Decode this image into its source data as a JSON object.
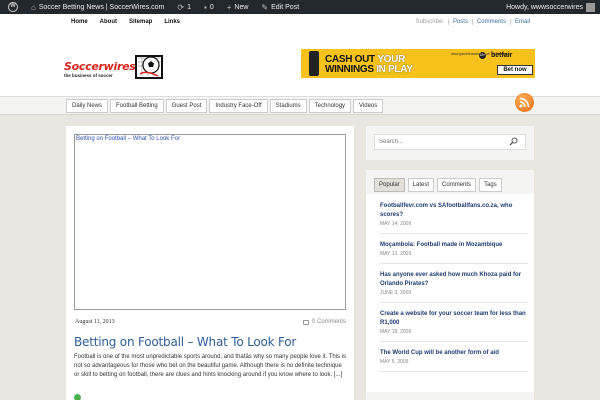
{
  "admin_bar": {
    "site_name": "Soccer Betting News | SoccerWires.com",
    "updates_count": "1",
    "comments_count": "0",
    "new_label": "New",
    "edit_label": "Edit Post",
    "howdy": "Howdy, wwwsoccerwires"
  },
  "top_nav": [
    "Home",
    "About",
    "Sitemap",
    "Links"
  ],
  "subscribe": {
    "label": "Subscribe:",
    "links": [
      "Posts",
      "Comments",
      "Email"
    ]
  },
  "logo": {
    "name": "Soccerwires",
    "tagline": "the business of soccer"
  },
  "banner": {
    "line1_a": "CASH OUT ",
    "line1_b": "YOUR",
    "line2_a": "WINNINGS ",
    "line2_b": "IN PLAY",
    "small": "www.gambleaware.co.uk T&C's Apply",
    "age": "18+",
    "brand": "betfair",
    "cta": "Bet now"
  },
  "main_nav": [
    "Daily News",
    "Football Betting",
    "Guest Post",
    "Industry Face-Off",
    "Stadiums",
    "Technology",
    "Videos"
  ],
  "post": {
    "embed_title": "Betting on Football – What To Look For",
    "date": "August 11, 2013",
    "comments": "0 Comments",
    "title": "Betting on Football – What To Look For",
    "excerpt": "Football is one of the most unpredictable sports around, and thatâs why so many people love it. This is not so advantageous for those who bet on the beautiful game. Although there is no definite technique or skill to betting on football, there are clues and hints knocking around if you know where to look. [...]"
  },
  "search": {
    "placeholder": "Search..."
  },
  "sidebar_tabs": [
    "Popular",
    "Latest",
    "Comments",
    "Tags"
  ],
  "popular_posts": [
    {
      "title": "Footballfevr.com vs SAfootballfans.co.za, who scores?",
      "date": "MAY 14, 2009"
    },
    {
      "title": "Moçambola: Football made in Mozambique",
      "date": "MAY 13, 2009"
    },
    {
      "title": "Has anyone ever asked how much Khoza paid for Orlando Pirates?",
      "date": "JUNE 3, 2009"
    },
    {
      "title": "Create a website for your soccer team for less than R1,000",
      "date": "MAY 18, 2009"
    },
    {
      "title": "The World Cup will be another form of aid",
      "date": "MAY 6, 2009"
    }
  ],
  "colors": {
    "admin_bar": "#23282d",
    "logo_red": "#d7261e",
    "link_blue": "#2f6098",
    "banner_yellow": "#f6c21b",
    "rss_orange": "#e86a10"
  }
}
